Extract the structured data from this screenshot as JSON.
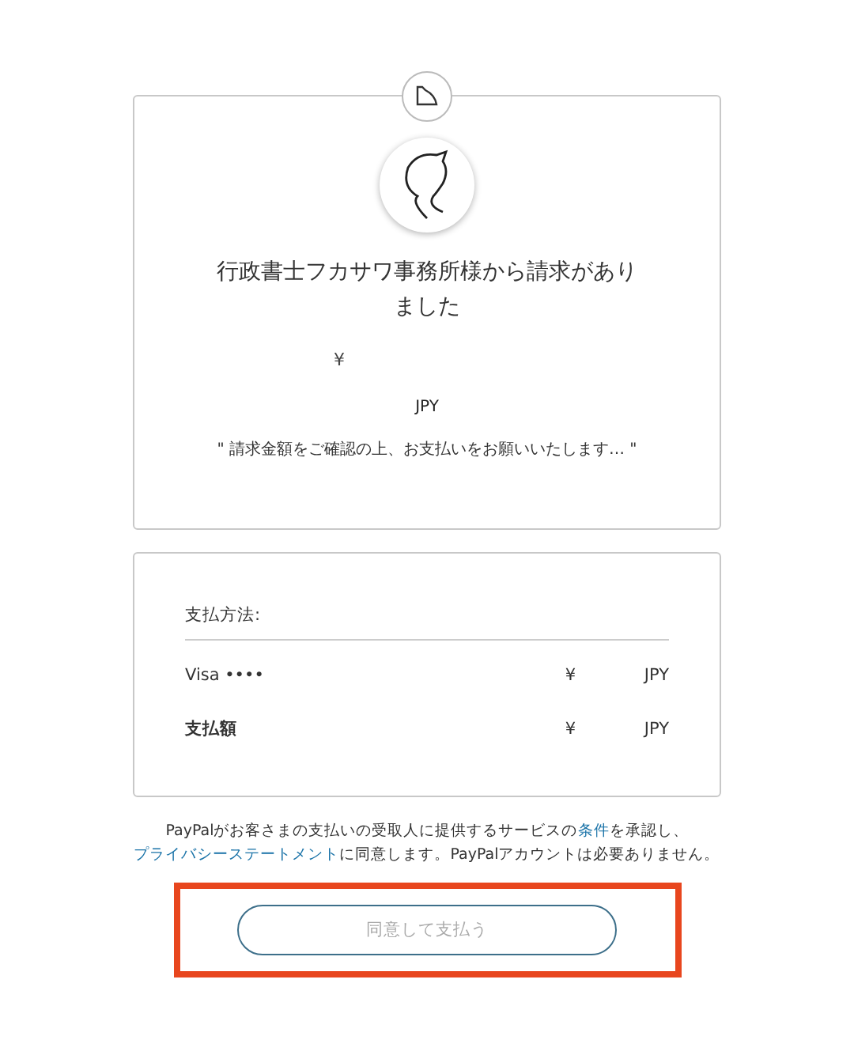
{
  "invoice": {
    "title": "行政書士フカサワ事務所様から請求がありました",
    "amount": "¥",
    "currency": "JPY",
    "note": "\" 請求金額をご確認の上、お支払いをお願いいたします… \""
  },
  "payment": {
    "heading": "支払方法:",
    "rows": [
      {
        "kind": "method",
        "label": "Visa ••••",
        "amount": "¥",
        "currency": "JPY"
      },
      {
        "kind": "total",
        "label": "支払額",
        "amount": "¥",
        "currency": "JPY"
      }
    ]
  },
  "legal": [
    {
      "kind": "text",
      "text": "PayPalがお客さまの支払いの受取人に提供するサービスの"
    },
    {
      "kind": "link",
      "text": "条件"
    },
    {
      "kind": "text",
      "text": "を承認し、"
    },
    {
      "kind": "link",
      "text": "プライバシーステートメント"
    },
    {
      "kind": "text",
      "text": "に同意します。PayPalアカウントは必要ありません。"
    }
  ],
  "pay_button": {
    "label": "同意して支払う",
    "disabled": true,
    "highlighted": true
  }
}
